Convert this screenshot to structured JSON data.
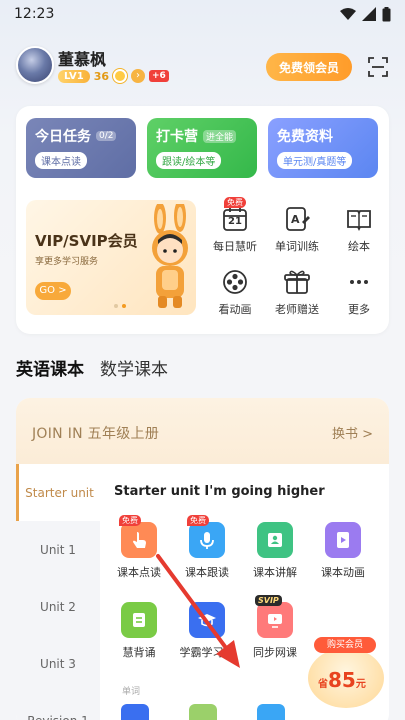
{
  "status_bar": {
    "time": "12:23"
  },
  "header": {
    "username": "董慕枫",
    "level": "LV1",
    "coins": "36",
    "plus_badge": "+6",
    "vip_button": "免费领会员"
  },
  "tiles": [
    {
      "title": "今日任务",
      "tag": "0/2",
      "sub": "课本点读"
    },
    {
      "title": "打卡营",
      "tag": "进全能",
      "sub": "跟读/绘本等"
    },
    {
      "title": "免费资料",
      "tag": "",
      "sub": "单元测/真题等"
    }
  ],
  "banner": {
    "title": "VIP/SVIP会员",
    "subtitle": "享更多学习服务",
    "go": "GO >"
  },
  "quick_actions": [
    {
      "label": "每日慧听",
      "icon": "calendar-icon",
      "badge": "免费",
      "date": "21"
    },
    {
      "label": "单词训练",
      "icon": "word-pen-icon",
      "badge": ""
    },
    {
      "label": "绘本",
      "icon": "book-icon",
      "badge": ""
    },
    {
      "label": "看动画",
      "icon": "film-reel-icon",
      "badge": ""
    },
    {
      "label": "老师赠送",
      "icon": "gift-icon",
      "badge": ""
    },
    {
      "label": "更多",
      "icon": "more-icon",
      "badge": ""
    }
  ],
  "subject_tabs": [
    "英语课本",
    "数学课本"
  ],
  "book": {
    "title": "JOIN IN 五年级上册",
    "change": "换书 >",
    "units": [
      "Starter unit",
      "Unit 1",
      "Unit 2",
      "Unit 3",
      "Revision 1"
    ],
    "active_unit_title": "Starter unit I'm going higher",
    "features": [
      {
        "label": "课本点读",
        "badge": "免费",
        "color": "#ff8a55"
      },
      {
        "label": "课本跟读",
        "badge": "免费",
        "color": "#3aa6f5"
      },
      {
        "label": "课本讲解",
        "badge": "",
        "color": "#3fc383"
      },
      {
        "label": "课本动画",
        "badge": "",
        "color": "#9b7bf0"
      },
      {
        "label": "慧背诵",
        "badge": "",
        "color": "#7acb45"
      },
      {
        "label": "学霸学习法",
        "badge": "",
        "color": "#3a6ff0"
      },
      {
        "label": "同步网课",
        "badge": "SVIP",
        "color": "#ff7a7a"
      }
    ],
    "section_word": "单词"
  },
  "promo": {
    "top": "购买会员",
    "prefix": "省",
    "amount": "85",
    "suffix": "元"
  },
  "colors": {
    "accent_orange": "#ff9c2a",
    "green": "#34b84a",
    "blue": "#5b86f1"
  }
}
